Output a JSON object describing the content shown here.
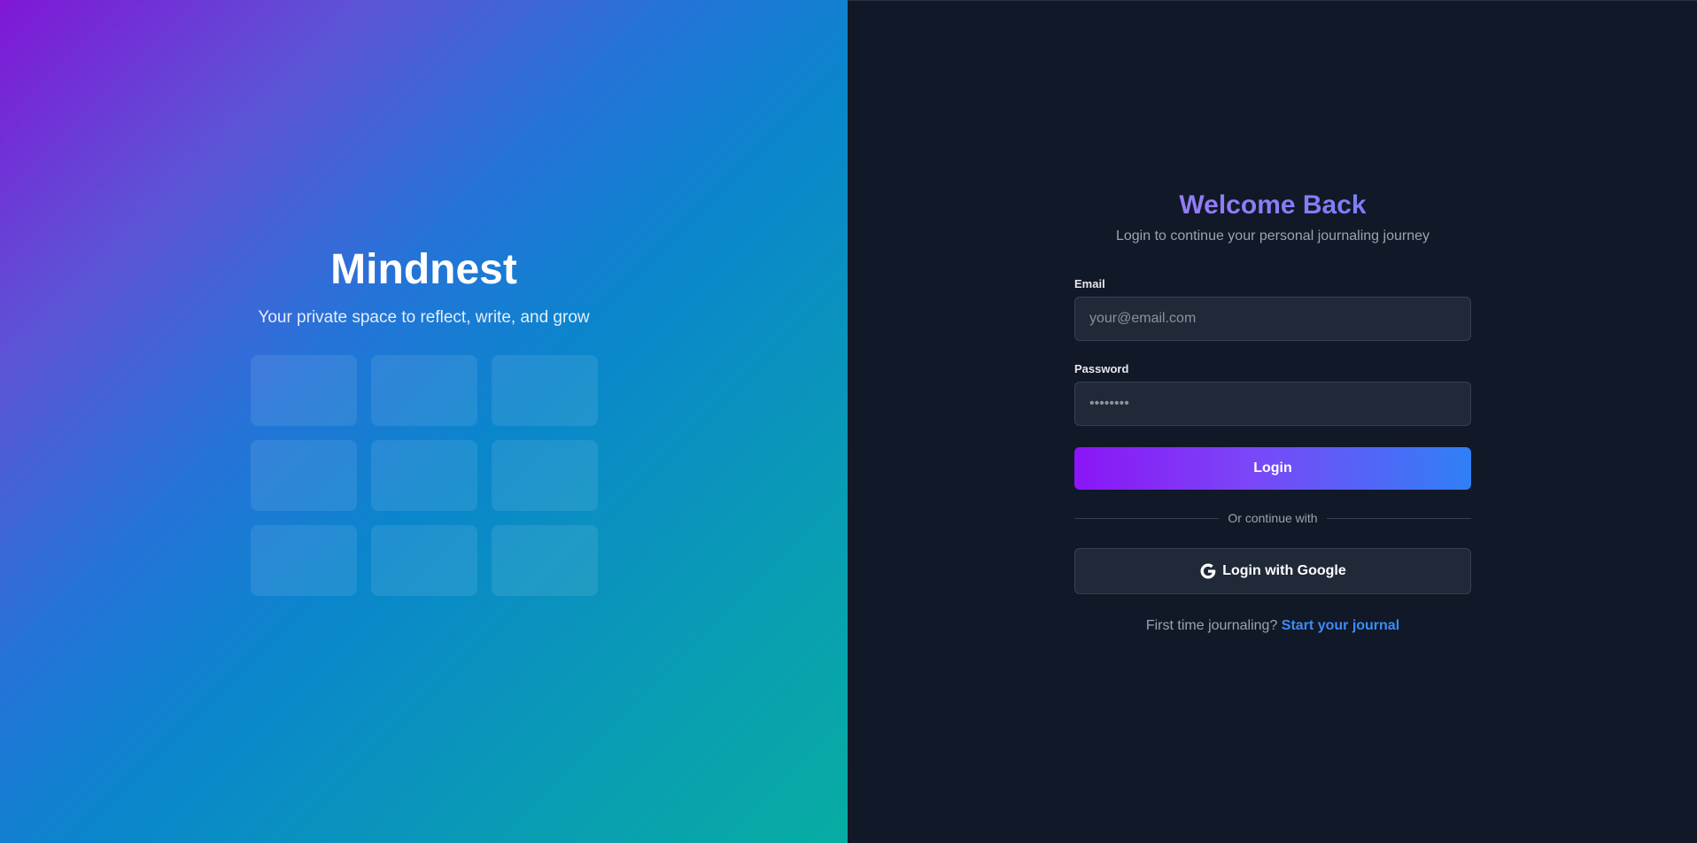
{
  "brand": {
    "name": "Mindnest",
    "tagline": "Your private space to reflect, write, and grow",
    "tile_count": 9
  },
  "login": {
    "title": "Welcome Back",
    "subtitle": "Login to continue your personal journaling journey",
    "email_label": "Email",
    "email_placeholder": "your@email.com",
    "email_value": "",
    "password_label": "Password",
    "password_placeholder": "••••••••",
    "password_value": "",
    "login_button": "Login",
    "divider_text": "Or continue with",
    "google_button": "Login with Google",
    "signup_prompt": "First time journaling?",
    "signup_link": "Start your journal"
  },
  "icons": {
    "google": "google-g-icon"
  },
  "colors": {
    "background": "#111827",
    "input_bg": "#1f2937",
    "link": "#3b8cf6",
    "gradient_start": "#8b15f6",
    "gradient_end": "#2f80f6"
  }
}
